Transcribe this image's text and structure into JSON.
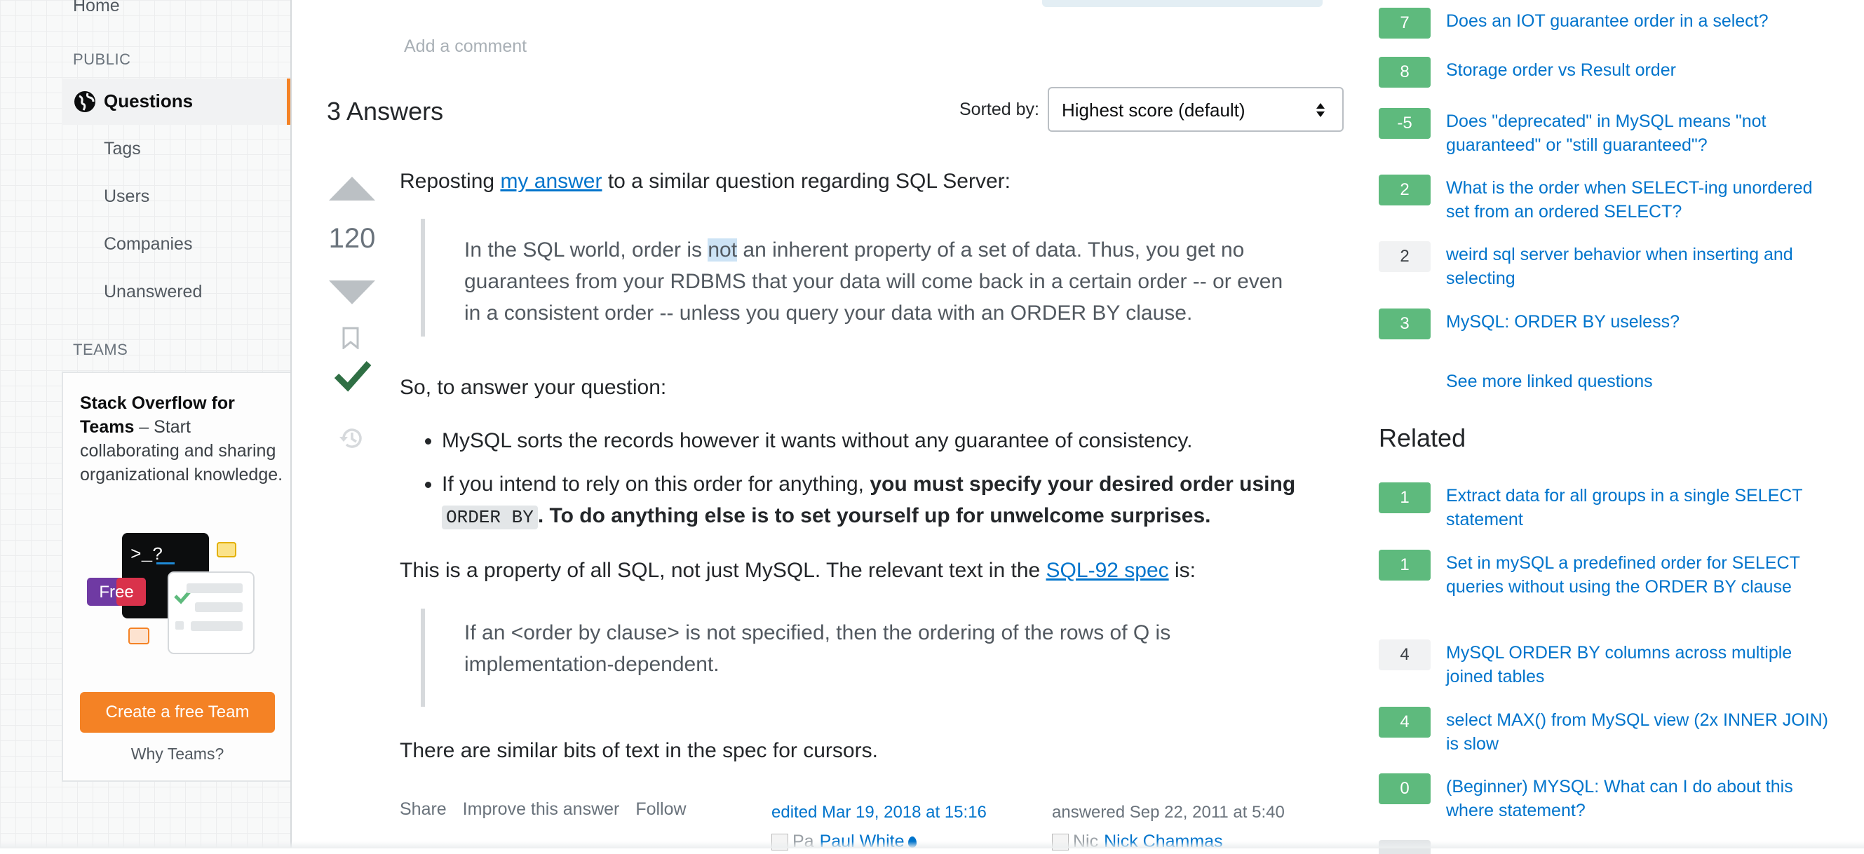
{
  "sidebar": {
    "home": "Home",
    "public_heading": "PUBLIC",
    "questions": "Questions",
    "tags": "Tags",
    "users": "Users",
    "companies": "Companies",
    "unanswered": "Unanswered",
    "teams_heading": "TEAMS",
    "teams_promo": {
      "title": "Stack Overflow for Teams",
      "body": " – Start collaborating and sharing organizational knowledge.",
      "terminal": ">_?",
      "free_tag": "Free",
      "button": "Create a free Team",
      "link": "Why Teams?"
    }
  },
  "comment": {
    "add": "Add a comment"
  },
  "answers": {
    "count_label": "3 Answers",
    "sorted_label": "Sorted by:",
    "sort_value": "Highest score (default)"
  },
  "answer": {
    "score": "120",
    "p1_before": "Reposting ",
    "p1_link": "my answer",
    "p1_after": " to a similar question regarding SQL Server:",
    "q1_before": "In the SQL world, order is ",
    "q1_highlight": "not",
    "q1_after": " an inherent property of a set of data. Thus, you get no guarantees from your RDBMS that your data will come back in a certain order -- or even in a consistent order -- unless you query your data with an ORDER BY clause.",
    "p2": "So, to answer your question:",
    "bullet1": "MySQL sorts the records however it wants without any guarantee of consistency.",
    "bullet2_plain": "If you intend to rely on this order for anything, ",
    "bullet2_bold1": "you must specify your desired order using ",
    "bullet2_code": "ORDER BY",
    "bullet2_bold2": ". To do anything else is to set yourself up for unwelcome surprises.",
    "p4_before": "This is a property of all SQL, not just MySQL. The relevant text in the ",
    "p4_link": "SQL-92 spec",
    "p4_after": " is:",
    "q2": "If an <order by clause> is not specified, then the ordering of the rows of Q is implementation-dependent.",
    "p5": "There are similar bits of text in the spec for cursors.",
    "menu": {
      "share": "Share",
      "improve": "Improve this answer",
      "follow": "Follow"
    },
    "edited": "edited Mar 19, 2018 at 15:16",
    "editor_alt": "Pa",
    "editor": "Paul White",
    "answered": "answered Sep 22, 2011 at 5:40",
    "author_alt": "Nic",
    "author": "Nick Chammas"
  },
  "linked": [
    {
      "score": "7",
      "title": "Does an IOT guarantee order in a select?",
      "accepted": true
    },
    {
      "score": "8",
      "title": "Storage order vs Result order",
      "accepted": true
    },
    {
      "score": "-5",
      "title": "Does \"deprecated\" in MySQL means \"not guaranteed\" or \"still guaranteed\"?",
      "accepted": true
    },
    {
      "score": "2",
      "title": "What is the order when SELECT-ing unordered set from an ordered SELECT?",
      "accepted": true
    },
    {
      "score": "2",
      "title": "weird sql server behavior when inserting and selecting",
      "accepted": false
    },
    {
      "score": "3",
      "title": "MySQL: ORDER BY useless?",
      "accepted": true
    }
  ],
  "see_more": "See more linked questions",
  "related_heading": "Related",
  "related": [
    {
      "score": "1",
      "title": "Extract data for all groups in a single SELECT statement",
      "accepted": true
    },
    {
      "score": "1",
      "title": "Set in mySQL a predefined order for SELECT queries without using the ORDER BY clause",
      "accepted": true
    },
    {
      "score": "4",
      "title": "MySQL ORDER BY columns across multiple joined tables",
      "accepted": false
    },
    {
      "score": "4",
      "title": "select MAX() from MySQL view (2x INNER JOIN) is slow",
      "accepted": true
    },
    {
      "score": "0",
      "title": "(Beginner) MYSQL: What can I do about this where statement?",
      "accepted": true
    }
  ],
  "colors": {
    "link": "#0074cc",
    "accepted_badge": "#5eba7d",
    "orange_accent": "#f48225",
    "accepted_check": "#2f6f44"
  },
  "icons": [
    "globe-icon",
    "vote-up-icon",
    "vote-down-icon",
    "bookmark-icon",
    "accepted-check-icon",
    "history-icon",
    "select-caret-icon"
  ]
}
